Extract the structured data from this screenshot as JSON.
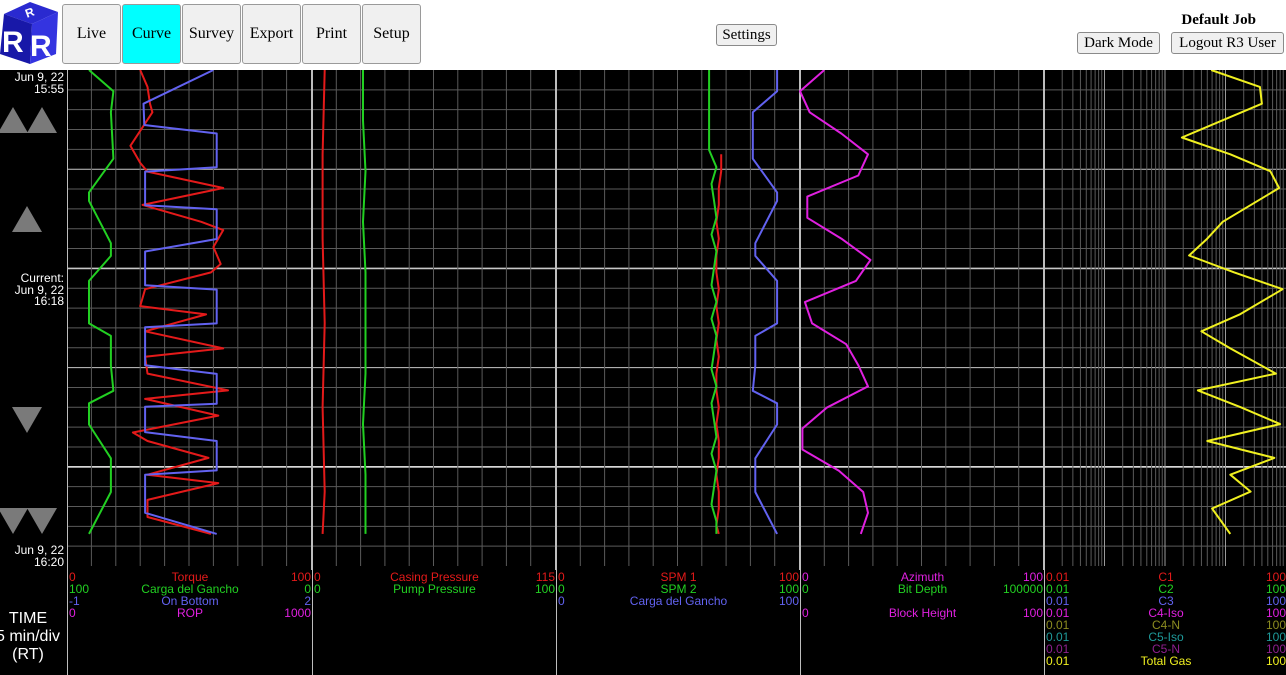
{
  "nav": {
    "buttons": [
      {
        "label": "Live",
        "active": false
      },
      {
        "label": "Curve",
        "active": true
      },
      {
        "label": "Survey",
        "active": false
      },
      {
        "label": "Export",
        "active": false
      },
      {
        "label": "Print",
        "active": false
      },
      {
        "label": "Setup",
        "active": false
      }
    ],
    "settings_label": "Settings",
    "dark_mode_label": "Dark Mode",
    "logout_label": "Logout R3 User",
    "job_title": "Default Job",
    "logo_letters": [
      "R",
      "R",
      "R"
    ]
  },
  "time": {
    "top_date": "Jun 9, 22",
    "top_time": "15:55",
    "current_label": "Current:",
    "current_date": "Jun 9, 22",
    "current_time": "16:18",
    "bottom_date": "Jun 9, 22",
    "bottom_time": "16:20",
    "axis_label": "TIME",
    "scale_label": "5 min/div",
    "mode_label": "(RT)"
  },
  "colors": {
    "red": "#e41a1a",
    "green": "#22d022",
    "blue": "#6262f0",
    "magenta": "#e020e0",
    "yellow": "#f0f020",
    "olive": "#8c8c20",
    "teal": "#1e9a9a",
    "purple": "#901f90"
  },
  "tracks": [
    {
      "scale": "linear",
      "legend": [
        {
          "min": "0",
          "name": "Torque",
          "max": "100",
          "color": "#e41a1a"
        },
        {
          "min": "100",
          "name": "Carga del Gancho",
          "max": "0",
          "color": "#22d022"
        },
        {
          "min": "-1",
          "name": "On Bottom",
          "max": "2",
          "color": "#6262f0"
        },
        {
          "min": "0",
          "name": "ROP",
          "max": "1000",
          "color": "#e020e0"
        }
      ]
    },
    {
      "scale": "linear",
      "legend": [
        {
          "min": "0",
          "name": "Casing Pressure",
          "max": "115",
          "color": "#e41a1a"
        },
        {
          "min": "0",
          "name": "Pump Pressure",
          "max": "100",
          "color": "#22d022"
        }
      ]
    },
    {
      "scale": "linear",
      "legend": [
        {
          "min": "0",
          "name": "SPM 1",
          "max": "100",
          "color": "#e41a1a"
        },
        {
          "min": "0",
          "name": "SPM 2",
          "max": "100",
          "color": "#22d022"
        },
        {
          "min": "0",
          "name": "Carga del Gancho",
          "max": "100",
          "color": "#6262f0"
        }
      ]
    },
    {
      "scale": "linear",
      "legend": [
        {
          "min": "0",
          "name": "Azimuth",
          "max": "100",
          "color": "#e020e0"
        },
        {
          "min": "0",
          "name": "Bit Depth",
          "max": "100000",
          "color": "#22d022"
        },
        {
          "min": "",
          "name": "",
          "max": "",
          "color": "#000000"
        },
        {
          "min": "0",
          "name": "Block Height",
          "max": "100",
          "color": "#e020e0"
        }
      ]
    },
    {
      "scale": "log",
      "legend": [
        {
          "min": "0.01",
          "name": "C1",
          "max": "100",
          "color": "#e41a1a"
        },
        {
          "min": "0.01",
          "name": "C2",
          "max": "100",
          "color": "#22d022"
        },
        {
          "min": "0.01",
          "name": "C3",
          "max": "100",
          "color": "#6262f0"
        },
        {
          "min": "0.01",
          "name": "C4-Iso",
          "max": "100",
          "color": "#e020e0"
        },
        {
          "min": "0.01",
          "name": "C4-N",
          "max": "100",
          "color": "#8c8c20"
        },
        {
          "min": "0.01",
          "name": "C5-Iso",
          "max": "100",
          "color": "#1e9a9a"
        },
        {
          "min": "0.01",
          "name": "C5-N",
          "max": "100",
          "color": "#901f90"
        },
        {
          "min": "0.01",
          "name": "Total Gas",
          "max": "100",
          "color": "#f0f020"
        }
      ]
    }
  ],
  "chart_data": {
    "type": "line",
    "time_start": "15:55",
    "time_current": "16:18",
    "time_end": "16:20",
    "series": [
      {
        "track": 0,
        "name": "Torque",
        "color": "#e41a1a",
        "min": 0,
        "max": 100,
        "t": [
          0,
          0.85,
          1.7,
          2.13,
          3.82,
          4.68,
          5.12,
          5.95,
          6.8,
          7.65,
          8.07,
          8.92,
          9.78,
          10.2,
          11.05,
          11.9,
          12.32,
          13.17,
          14.03,
          14.45,
          15.3,
          16.15,
          16.58,
          17.42,
          18.27,
          18.7,
          19.55,
          20.4,
          20.82,
          21.67,
          22.53,
          23.38
        ],
        "v": [
          30,
          33,
          34,
          35,
          26,
          30,
          33,
          64,
          31,
          55,
          64,
          60,
          63,
          59,
          32,
          30,
          57,
          32,
          64,
          32,
          33,
          66,
          32,
          62,
          27,
          33,
          58,
          33,
          62,
          33,
          33,
          59
        ]
      },
      {
        "track": 0,
        "name": "Carga del Gancho",
        "color": "#22d022",
        "min": 100,
        "max": 0,
        "t": [
          0,
          1.07,
          2.13,
          4.47,
          6.17,
          6.6,
          8.73,
          9.37,
          10.63,
          12.77,
          13.4,
          14.9,
          16.17,
          16.8,
          17.87,
          19.57,
          21.27,
          23.38
        ],
        "v": [
          91,
          81,
          82,
          81,
          91,
          91,
          82,
          82,
          91,
          91,
          82,
          82,
          81,
          91,
          91,
          82,
          82,
          91
        ]
      },
      {
        "track": 0,
        "name": "On Bottom",
        "color": "#6262f0",
        "min": -1,
        "max": 2,
        "t": [
          0,
          1.7,
          2.77,
          3.2,
          4.9,
          5.12,
          6.82,
          7.02,
          8.52,
          9.15,
          10.85,
          11.07,
          12.77,
          12.97,
          14.88,
          15.32,
          16.82,
          16.97,
          18.25,
          18.7,
          20.18,
          20.4,
          22.32,
          23.38
        ],
        "v": [
          0.8,
          -0.06,
          -0.05,
          0.84,
          0.84,
          -0.04,
          -0.04,
          0.84,
          0.84,
          -0.04,
          -0.04,
          0.84,
          0.84,
          -0.04,
          -0.04,
          0.84,
          0.84,
          -0.04,
          -0.04,
          0.84,
          0.84,
          -0.04,
          -0.04,
          0.84
        ]
      },
      {
        "track": 1,
        "name": "Casing Pressure",
        "color": "#e41a1a",
        "min": 0,
        "max": 115,
        "t": [
          0,
          4.25,
          8.5,
          12.75,
          17,
          21.25,
          23.38
        ],
        "v": [
          6,
          5,
          5,
          6,
          5,
          6,
          5
        ]
      },
      {
        "track": 1,
        "name": "Pump Pressure",
        "color": "#22d022",
        "min": 0,
        "max": 100,
        "t": [
          0,
          2.55,
          5.1,
          7.65,
          10.2,
          12.75,
          15.3,
          17.85,
          20.4,
          23.38
        ],
        "v": [
          21,
          21,
          22,
          21,
          22,
          22,
          22,
          21,
          22,
          22
        ]
      },
      {
        "track": 2,
        "name": "SPM 1",
        "color": "#e41a1a",
        "min": 0,
        "max": 100,
        "t": [
          4.25,
          5.1,
          5.95,
          6.8,
          7.65,
          8.5,
          9.35,
          10.2,
          11.05,
          11.9,
          12.75,
          13.6,
          14.45,
          15.3,
          16.15,
          17,
          17.85,
          18.7,
          19.55,
          20.4,
          21.25,
          22.1,
          22.95,
          23.38
        ],
        "v": [
          68,
          68,
          67,
          67,
          66,
          67,
          66,
          66,
          67,
          66,
          67,
          66,
          67,
          66,
          66,
          67,
          66,
          67,
          67,
          66,
          67,
          67,
          66,
          67
        ]
      },
      {
        "track": 2,
        "name": "SPM 2",
        "color": "#22d022",
        "min": 0,
        "max": 100,
        "t": [
          0,
          4.03,
          4.9,
          5.74,
          6.58,
          7.44,
          8.29,
          9.14,
          9.99,
          10.84,
          11.69,
          12.54,
          13.39,
          14.24,
          15.09,
          15.94,
          16.79,
          17.64,
          18.49,
          19.34,
          20.19,
          21.04,
          21.89,
          22.74,
          23.38
        ],
        "v": [
          63,
          63,
          66,
          64,
          65,
          66,
          64,
          66,
          65,
          64,
          66,
          64,
          66,
          65,
          64,
          66,
          64,
          65,
          66,
          64,
          66,
          65,
          64,
          66,
          66
        ]
      },
      {
        "track": 2,
        "name": "Carga del Gancho",
        "color": "#6262f0",
        "min": 0,
        "max": 100,
        "t": [
          0,
          1.07,
          2.13,
          4.47,
          6.17,
          6.6,
          8.73,
          9.37,
          10.63,
          12.77,
          13.4,
          14.9,
          16.17,
          16.8,
          17.87,
          19.57,
          21.27,
          23.38
        ],
        "v": [
          91,
          91,
          81,
          81,
          91,
          91,
          82,
          82,
          91,
          91,
          82,
          82,
          81,
          91,
          91,
          82,
          82,
          91
        ]
      },
      {
        "track": 3,
        "name": "Azimuth",
        "color": "#e020e0",
        "min": 0,
        "max": 100,
        "t": [
          0,
          1.07,
          2.13,
          3.2,
          4.25,
          5.32,
          6.38,
          7.45,
          8.5,
          9.57,
          10.63,
          11.7,
          12.77,
          13.82,
          14.88,
          15.95,
          17.02,
          18.07,
          19.13,
          20.2,
          21.27,
          22.32,
          23.38
        ],
        "v": [
          10,
          0,
          4,
          17,
          28,
          24,
          3,
          3,
          17,
          29,
          23,
          2,
          5,
          19,
          24,
          28,
          11,
          1,
          1,
          16,
          26,
          28,
          25
        ]
      },
      {
        "track": 4,
        "name": "Total Gas",
        "color": "#f0f020",
        "min": 0.01,
        "max": 100,
        "t": [
          0,
          0.85,
          1.7,
          3.4,
          4.25,
          5.1,
          5.95,
          7.65,
          8.5,
          9.35,
          10.2,
          11.05,
          12.33,
          13.17,
          14.03,
          15.3,
          16.15,
          17,
          17.85,
          18.7,
          19.55,
          20.4,
          21.25,
          22.1,
          23.38
        ],
        "v": [
          5.8,
          37,
          40,
          1.9,
          12,
          55,
          77,
          9,
          5,
          2.5,
          14,
          88,
          17,
          4,
          12,
          68,
          3.5,
          18,
          80,
          5,
          64,
          12,
          26,
          6,
          12
        ]
      }
    ]
  }
}
